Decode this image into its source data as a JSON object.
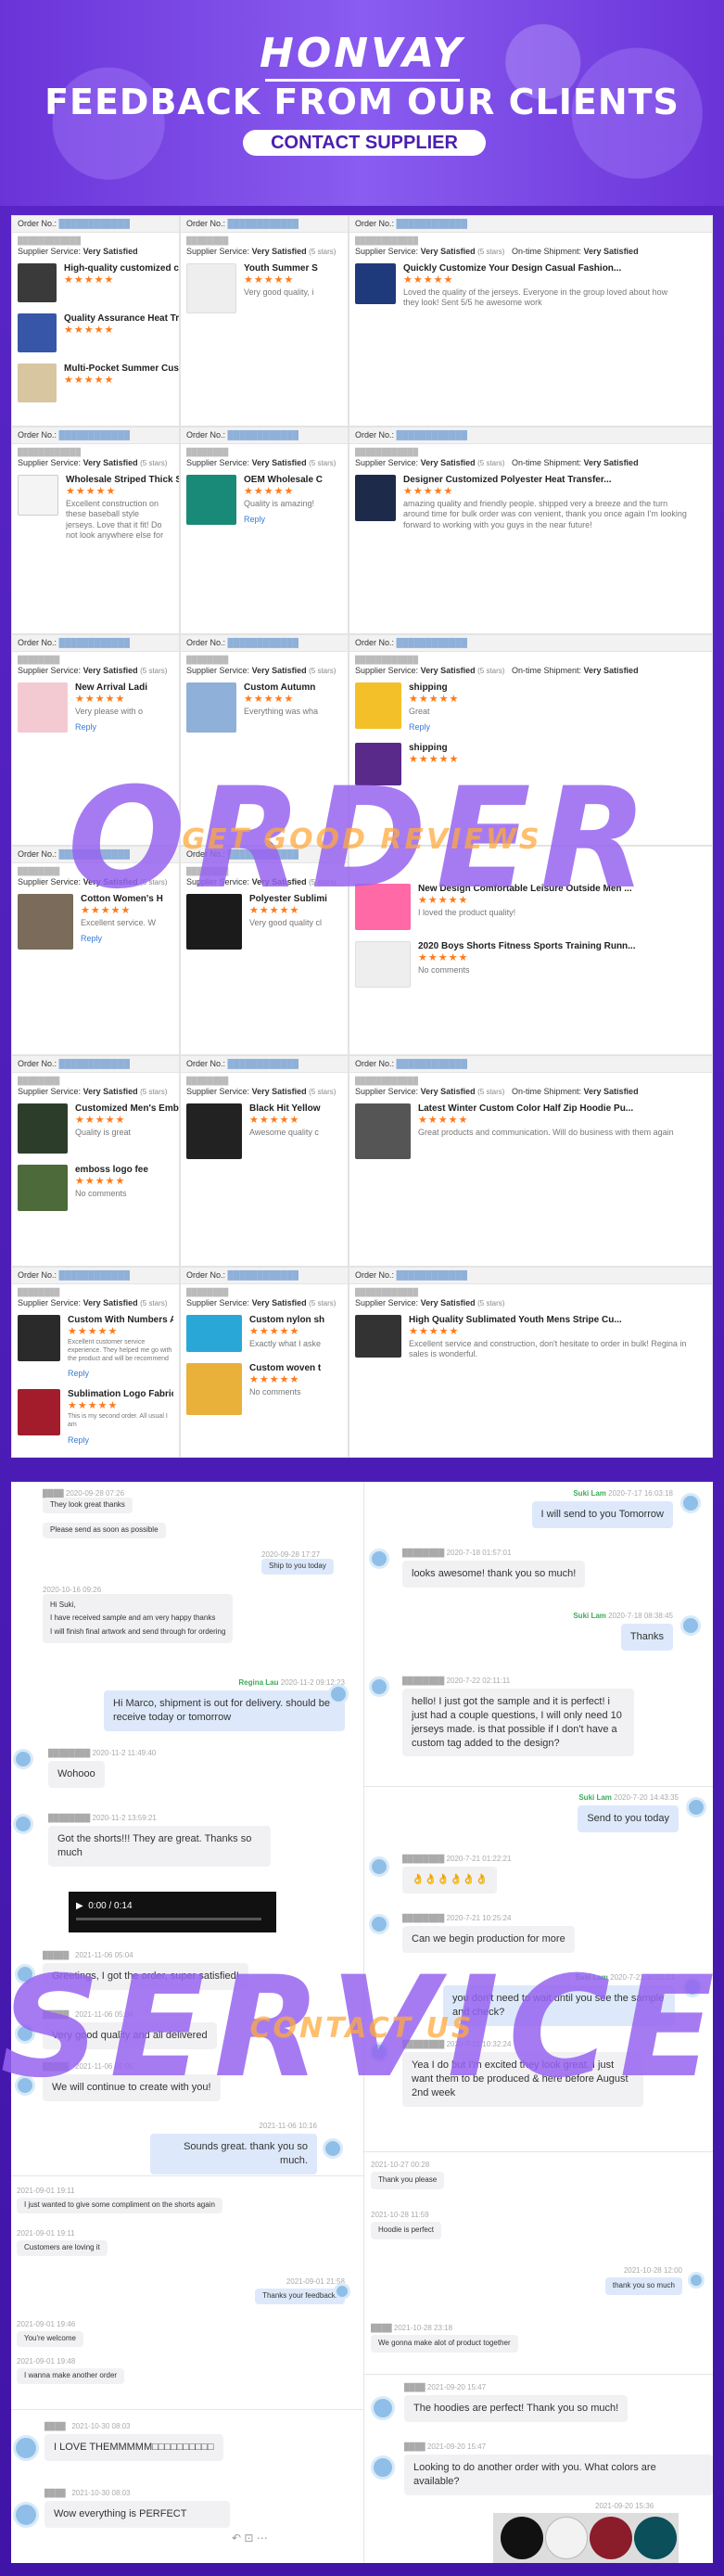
{
  "header": {
    "logo": "HONVAY",
    "title": "FEEDBACK FROM OUR CLIENTS",
    "cta": "CONTACT SUPPLIER"
  },
  "overlays": {
    "order_big": "ORDER",
    "order_sub": "GET GOOD REVIEWS",
    "service_big": "SERVICE",
    "service_sub": "CONTACT US"
  },
  "orders": {
    "order_label": "Order No.:",
    "service_label": "Supplier Service:",
    "very_satisfied": "Very Satisfied",
    "five_stars": "(5 stars)",
    "ontime_label": "On-time Shipment:",
    "reply": "Reply",
    "no_comments": "No comments",
    "items": {
      "c1a_t": "High-quality customized compet",
      "c1b_t": "Quality Assurance Heat Transfer P",
      "c1c_t": "Multi-Pocket Summer Custom Log",
      "c2_t": "Youth Summer S",
      "c2_c": "Very good quality, i",
      "c3_t": "Quickly Customize Your Design Casual Fashion...",
      "c3_c": "Loved the quality of the jerseys. Everyone in the group loved about how they look! Sent 5/5 he awesome work",
      "c4_t": "Wholesale Striped Thick Style C",
      "c4_c": "Excellent construction on these baseball style jerseys. Love that it fit! Do not look anywhere else for",
      "c5_t": "OEM Wholesale C",
      "c5_c": "Quality is amazing!",
      "c6_t": "Designer Customized Polyester Heat Transfer...",
      "c6_c": "amazing quality and friendly people. shipped very a breeze and the turn around time for bulk order was con venient, thank you once again I'm looking forward to working with you guys in the near future!",
      "c7_t": "New Arrival Ladi",
      "c7_c": "Very please with o",
      "c8_t": "Custom Autumn",
      "c8_c": "Everything was wha",
      "c9a_t": "shipping",
      "c9a_c": "Great",
      "c9b_t": "shipping",
      "c10_t": "Cotton Women's H",
      "c10_c": "Excellent service. W",
      "c11_t": "Polyester Sublimi",
      "c11_c": "Very good quality cl",
      "c12a_t": "New Design Comfortable Leisure Outside Men ...",
      "c12a_c": "I loved the product quality!",
      "c12b_t": "2020 Boys Shorts Fitness Sports Training Runn...",
      "c13a_t": "Customized Men's Emb",
      "c13a_c": "Quality is great",
      "c13b_t": "emboss logo fee",
      "c14_t": "Black Hit Yellow",
      "c14_c": "Awesome quality c",
      "c15_t": "Latest Winter Custom Color Half Zip Hoodie Pu...",
      "c15_c": "Great products and communication. Will do business with them again",
      "c16a_t": "Custom With Numbers And Name",
      "c16a_c": "Excellent customer service experience. They helped me go with the product and will be recommend",
      "c16b_t": "Sublimation Logo Fabric Quick-D",
      "c16b_c": "This is my second order. All usual I am",
      "c17a_t": "Custom nylon sh",
      "c17a_c": "Exactly what I aske",
      "c17b_t": "Custom woven t",
      "c18_t": "High Quality Sublimated Youth Mens Stripe Cu...",
      "c18_c": "Excellent service and construction, don't hesitate to order in bulk! Regina in sales is wonderful."
    }
  },
  "chat": {
    "left": {
      "m1": "They look great thanks",
      "m2": "Please send as soon as possible",
      "m3": "Ship to you today",
      "m4a": "Hi Suki,",
      "m4b": "I have received sample and am very happy thanks",
      "m4c": "I will finish final artwork and send through for ordering",
      "regina_name": "Regina Lau",
      "regina_time": "2020-11-2 09:12:23",
      "m5": "Hi Marco, shipment is out for delivery. should be receive today or tomorrow",
      "t6": "2020-11-2 11:49:40",
      "m6": "Wohooo",
      "t7": "2020-11-2 13:59:21",
      "m7": "Got the shorts!!! They are great. Thanks so much",
      "video_time": "0:00 / 0:14",
      "t8": "2021-11-06 05:04",
      "m8": "Greetings, I got the order, super satisfied!",
      "t9": "2021-11-06 05:04",
      "m9": "Very good quality and all delivered",
      "t10": "2021-11-06 05:05",
      "m10": "We will continue to create with you!",
      "t11": "2021-11-06 10:16",
      "m11": "Sounds great. thank you so much.",
      "t12": "2021-09-01 19:11",
      "m12": "I just wanted to give some compliment on the shorts again",
      "t13": "2021-09-01 19:11",
      "m13": "Customers are loving it",
      "t14": "2021-09-01 21:58",
      "m14": "Thanks your feedback!",
      "t15": "2021-09-01 19:46",
      "m15": "You're welcome",
      "t16": "2021-09-01 19:48",
      "m16": "I wanna make another order",
      "t17": "2021-10-30 08:03",
      "m17": "I LOVE THEMMMMM□□□□□□□□□□",
      "t18": "2021-10-30 08:03",
      "m18": "Wow everything is PERFECT"
    },
    "right": {
      "suki_name": "Suki Lam",
      "r1_time": "2020-7-17 16:03:18",
      "r1": "I will send to you Tomorrow",
      "r2_time": "2020-7-18 01:57:01",
      "r2": "looks awesome! thank you so much!",
      "r3_time": "2020-7-18 08:38:45",
      "r3": "Thanks",
      "r4_time": "2020-7-22 02:11:11",
      "r4": "hello! I just got the sample and it is perfect! i just had a couple questions, I will only need 10 jerseys made. is that possible if I don't have a custom tag added to the design?",
      "r5_time": "2020-7-20 14:43:35",
      "r5": "Send to you today",
      "r6_time": "2020-7-21 01:22:21",
      "r6": "👌👌👌👌👌👌",
      "r7_time": "2020-7-21 10:25:24",
      "r7": "Can we begin production for more",
      "r8_time": "2020-7-21 10:31:21",
      "r8": "you don't need to wait until you see the sample and check?",
      "r9_time": "2020-7-21 10:32:24",
      "r9": "Yea I do but I'm excited they look great. I just want them to be produced & here before August 2nd week",
      "r10_time": "2021-10-27 00:28",
      "r10": "Thank you please",
      "r11_time": "2021-10-28 11:59",
      "r11": "Hoodie is perfect",
      "r12_time": "2021-10-28 12:00",
      "r12": "thank you so much",
      "r13_time": "2021-10-28 23:18",
      "r13": "We gonna make alot of product together",
      "r14_time": "2021-09-20 15:47",
      "r14": "The hoodies are perfect! Thank you so much!",
      "r15_time": "2021-09-20 15:47",
      "r15": "Looking to do another order with you. What colors are available?",
      "r16_time": "2021-09-20 15:36"
    }
  },
  "colors": {
    "brand_purple": "#5b26c9",
    "star_orange": "#ff7a1a",
    "online_green": "#3cab58",
    "link_blue": "#3a7bd5"
  }
}
